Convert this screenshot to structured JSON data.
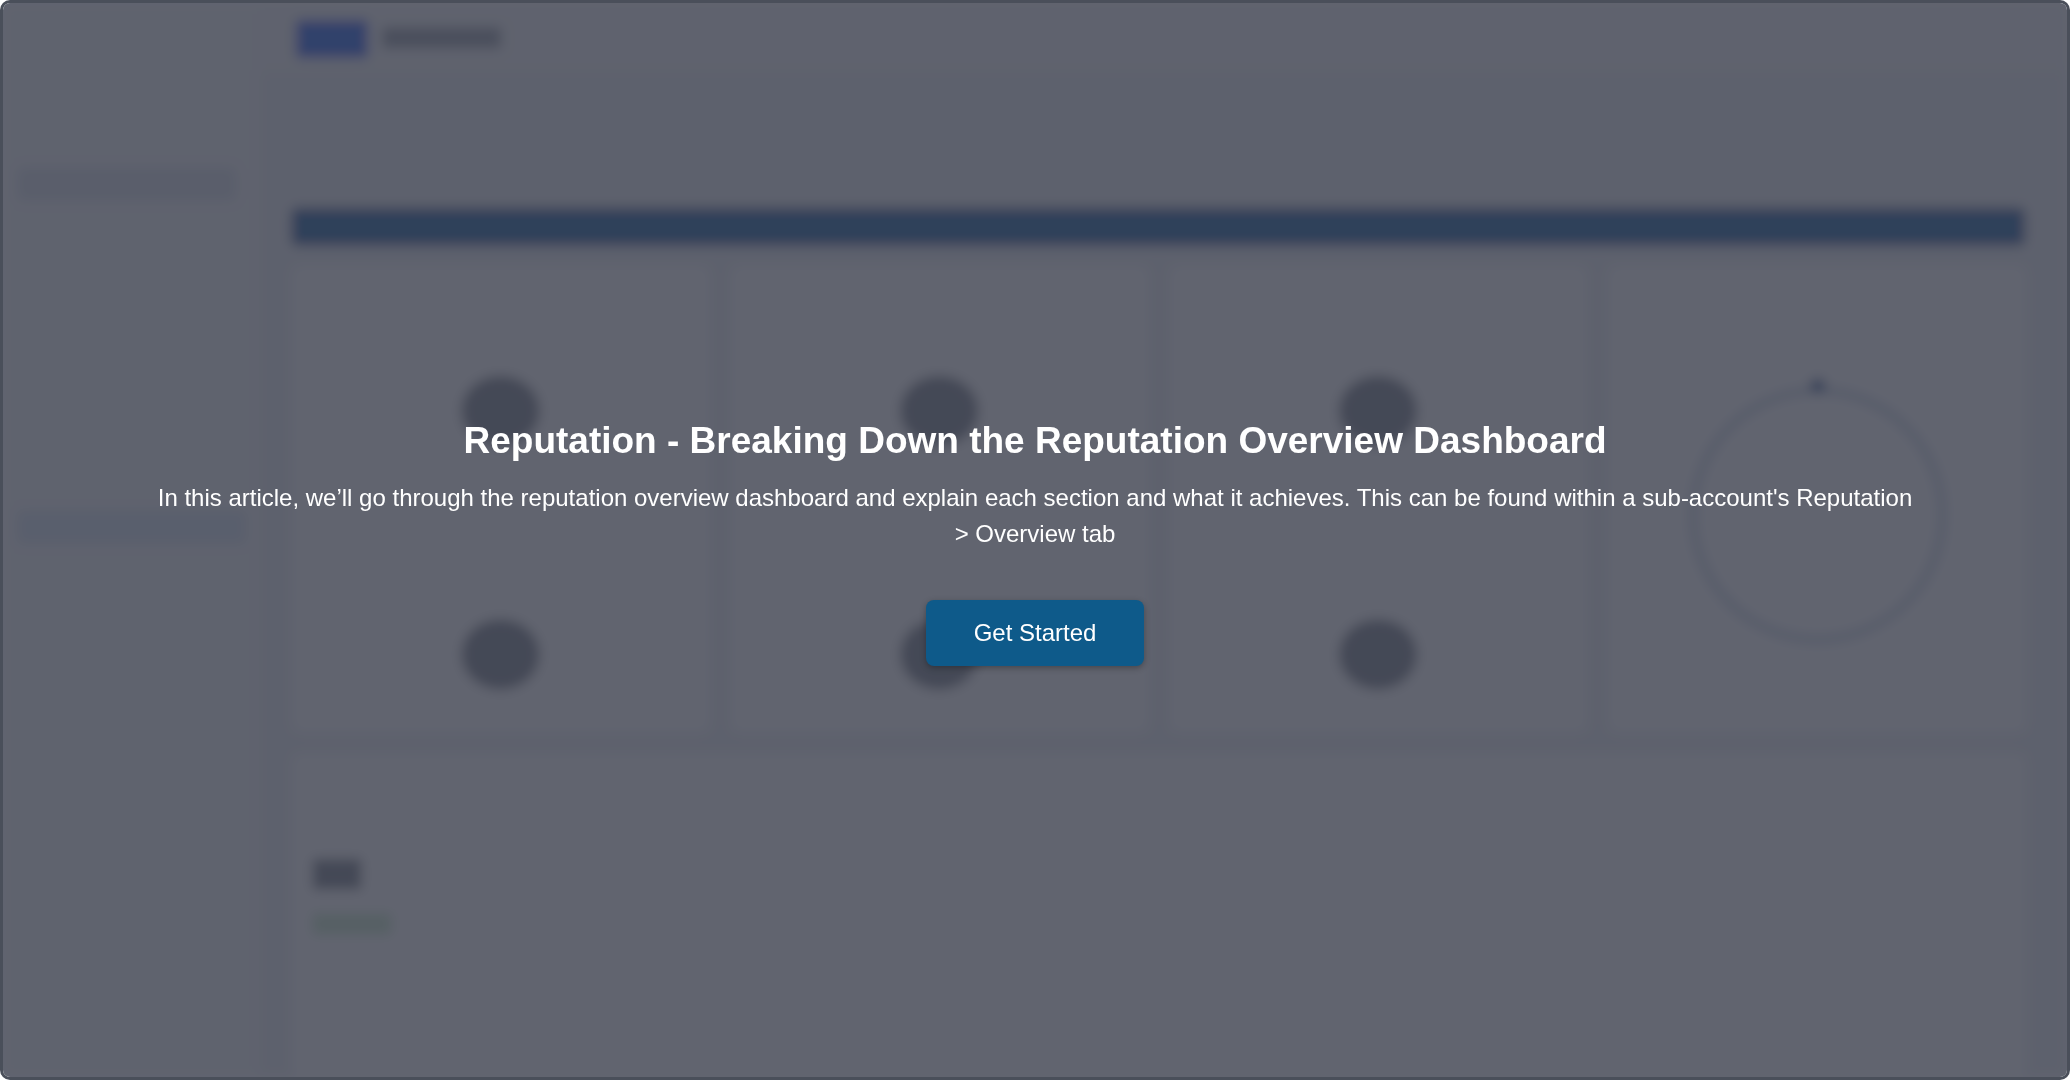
{
  "overlay": {
    "title": "Reputation - Breaking Down the Reputation Overview Dashboard",
    "description": "In this article, we’ll go through the reputation overview dashboard and explain each section and what it achieves. This can be found within a sub-account's Reputation > Overview tab",
    "button": "Get Started"
  }
}
